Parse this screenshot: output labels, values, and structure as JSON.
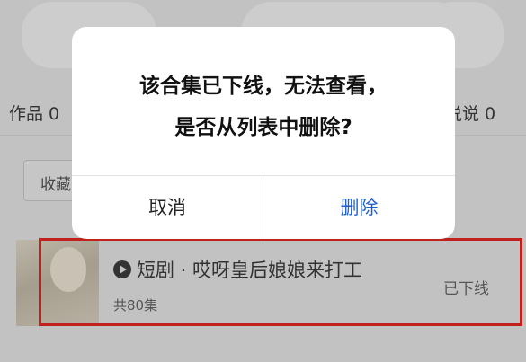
{
  "background": {
    "tabs": {
      "works": "作品 0",
      "says": "说说 0"
    },
    "collect_button": "收藏",
    "item": {
      "icon": "play-circle-icon",
      "title": "短剧 · 哎呀皇后娘娘来打工",
      "count": "共80集",
      "status": "已下线"
    }
  },
  "dialog": {
    "message_line1": "该合集已下线，无法查看，",
    "message_line2": "是否从列表中删除?",
    "cancel_label": "取消",
    "delete_label": "删除"
  },
  "colors": {
    "highlight_border": "#c0211c",
    "delete_accent": "#1d5fcc",
    "overlay": "#c2c2c2"
  }
}
